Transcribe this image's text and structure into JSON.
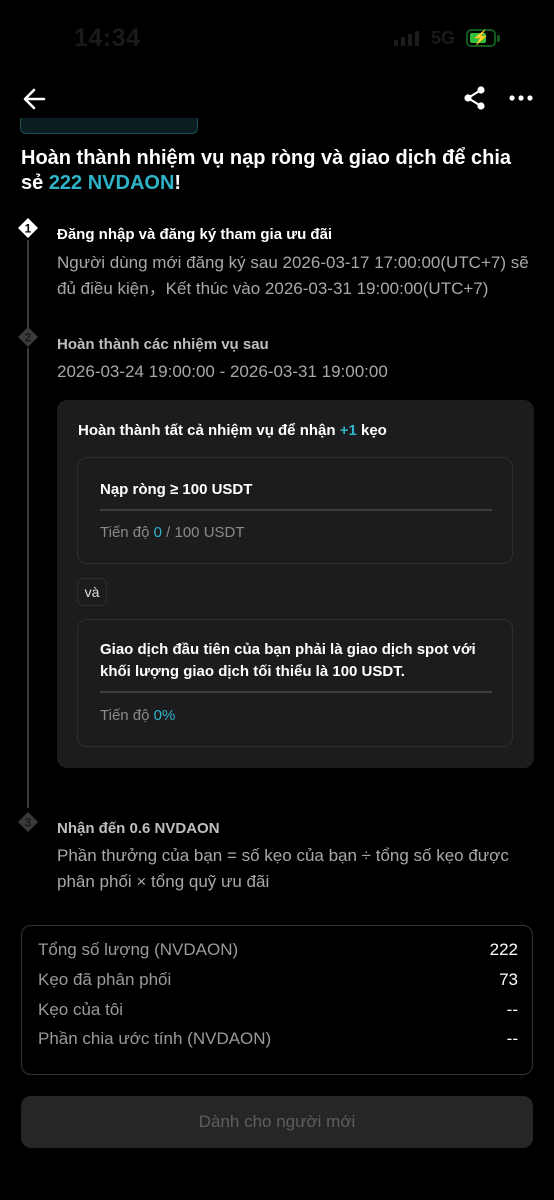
{
  "status_bar": {
    "time": "14:34",
    "network": "5G",
    "battery_percent": 62
  },
  "header": {
    "back_icon": "arrow-left-icon",
    "share_icon": "share-icon",
    "more_icon": "more-horizontal-icon"
  },
  "headline": {
    "text": "Hoàn thành nhiệm vụ nạp ròng và giao dịch để chia sẻ ",
    "amount": "222 NVDAON",
    "suffix": "!"
  },
  "steps": [
    {
      "number": "1",
      "title": "Đăng nhập và đăng ký tham gia ưu đãi",
      "text": "Người dùng mới đăng ký sau 2026-03-17 17:00:00(UTC+7) sẽ đủ điều kiện，Kết thúc vào 2026-03-31 19:00:00(UTC+7)"
    },
    {
      "number": "2",
      "title": "Hoàn thành các nhiệm vụ sau",
      "text": "2026-03-24 19:00:00 - 2026-03-31 19:00:00"
    },
    {
      "number": "3",
      "title": "Nhận đến 0.6 NVDAON",
      "text": "Phần thưởng của bạn = số kẹo của bạn ÷ tổng số kẹo được phân phối × tổng quỹ ưu đãi"
    }
  ],
  "task_card": {
    "title_prefix": "Hoàn thành tất cả nhiệm vụ để nhận ",
    "reward": "+1",
    "title_suffix": " kẹo",
    "connector": "và",
    "tasks": [
      {
        "name": "Nạp ròng ≥ 100 USDT",
        "progress_label": "Tiến độ ",
        "progress_current": "0",
        "progress_rest": " / 100 USDT",
        "progress": 0
      },
      {
        "name": "Giao dịch đầu tiên của bạn phải là giao dịch spot với khối lượng giao dịch tối thiểu là 100 USDT.",
        "progress_label": "Tiến độ ",
        "progress_current": "0%",
        "progress_rest": "",
        "progress": 0
      }
    ]
  },
  "summary": [
    {
      "label": "Tổng số lượng (NVDAON)",
      "value": "222"
    },
    {
      "label": "Kẹo đã phân phối",
      "value": "73"
    },
    {
      "label": "Kẹo của tôi",
      "value": "--"
    },
    {
      "label": "Phần chia ước tính (NVDAON)",
      "value": "--"
    }
  ],
  "cta": {
    "label": "Dành cho người mới",
    "enabled": false
  },
  "colors": {
    "accent": "#2db4c8",
    "background": "#000000",
    "card": "#1c1c1e"
  }
}
